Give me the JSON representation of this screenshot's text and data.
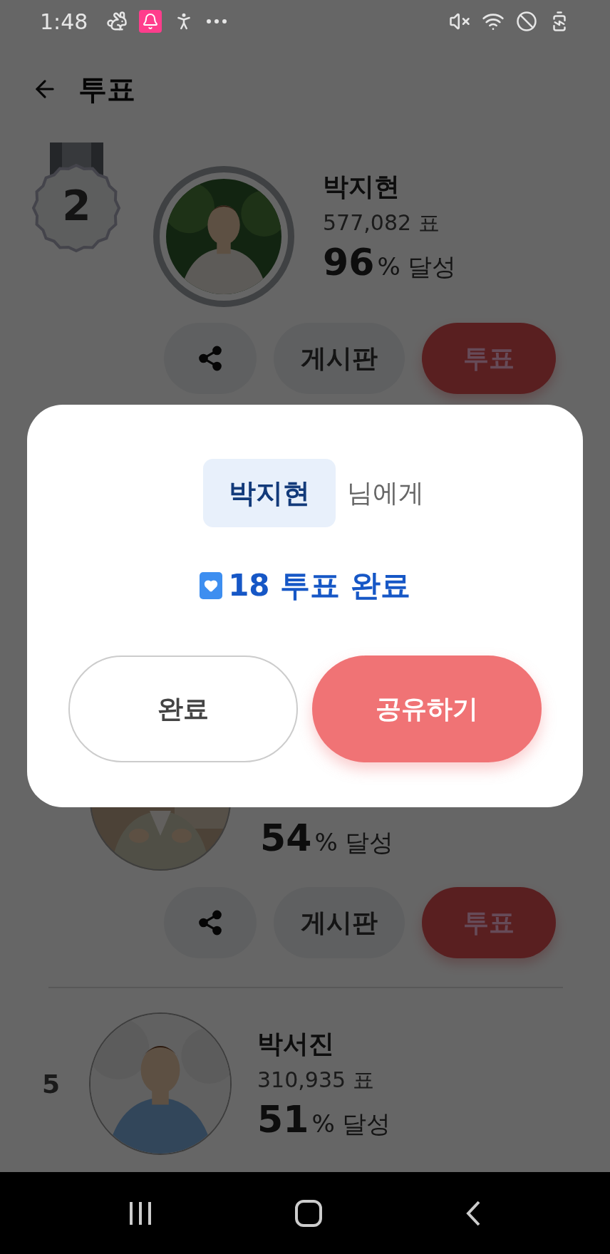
{
  "status_bar": {
    "time": "1:48"
  },
  "header": {
    "title": "투표"
  },
  "candidates": [
    {
      "kind": "medal",
      "rank": "2",
      "name": "박지현",
      "votes": "577,082 표",
      "percent": "96",
      "percent_suffix": "% 달성",
      "buttons": [
        "게시판",
        "투표"
      ]
    },
    {
      "kind": "partial",
      "percent": "54",
      "percent_suffix": "% 달성",
      "buttons": [
        "게시판",
        "투표"
      ]
    },
    {
      "kind": "plain",
      "rank": "5",
      "name": "박서진",
      "votes": "310,935 표",
      "percent": "51",
      "percent_suffix": "% 달성"
    }
  ],
  "dialog": {
    "recipient": "박지현",
    "recipient_suffix": "님에게",
    "message": "18 투표 완료",
    "buttons": [
      {
        "label": "완료",
        "kind": "outline"
      },
      {
        "label": "공유하기",
        "kind": "primary"
      }
    ]
  }
}
